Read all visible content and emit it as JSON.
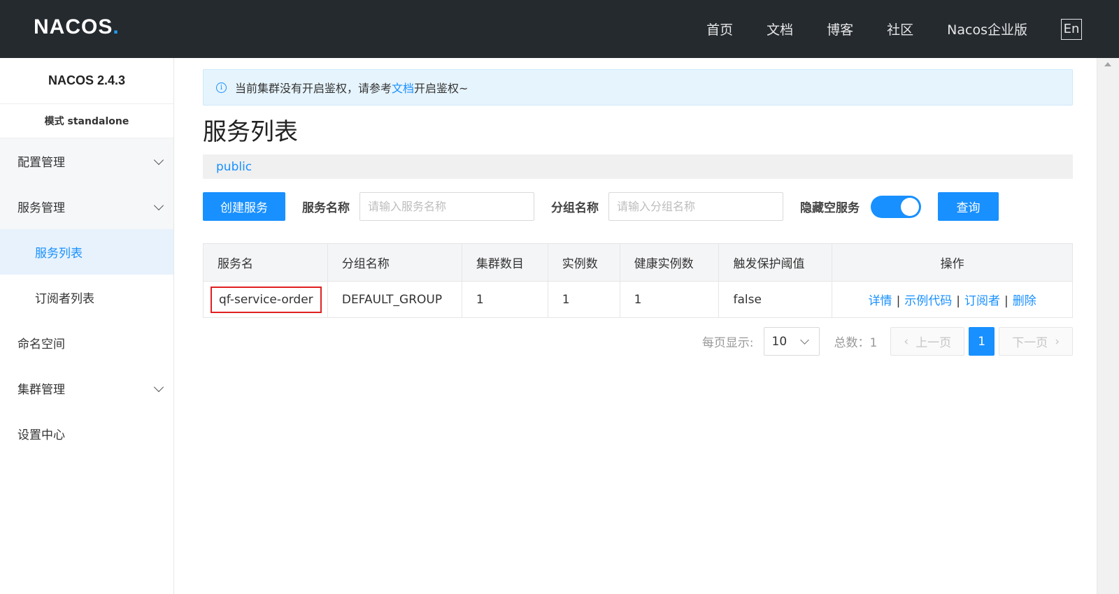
{
  "header": {
    "logo": "NACOS",
    "logo_dot": ".",
    "nav": [
      "首页",
      "文档",
      "博客",
      "社区",
      "Nacos企业版"
    ],
    "lang": "En"
  },
  "sidebar": {
    "version": "NACOS 2.4.3",
    "mode": "模式 standalone",
    "items": [
      {
        "label": "配置管理"
      },
      {
        "label": "服务管理"
      },
      {
        "label": "服务列表"
      },
      {
        "label": "订阅者列表"
      },
      {
        "label": "命名空间"
      },
      {
        "label": "集群管理"
      },
      {
        "label": "设置中心"
      }
    ]
  },
  "alert": {
    "prefix": "当前集群没有开启鉴权，请参考",
    "link": "文档",
    "suffix": "开启鉴权~"
  },
  "page": {
    "title": "服务列表",
    "namespace": "public"
  },
  "toolbar": {
    "create_label": "创建服务",
    "service_name_label": "服务名称",
    "service_name_placeholder": "请输入服务名称",
    "group_name_label": "分组名称",
    "group_name_placeholder": "请输入分组名称",
    "hide_empty_label": "隐藏空服务",
    "hide_empty_on": true,
    "query_label": "查询"
  },
  "table": {
    "headers": [
      "服务名",
      "分组名称",
      "集群数目",
      "实例数",
      "健康实例数",
      "触发保护阈值",
      "操作"
    ],
    "rows": [
      {
        "service": "qf-service-order",
        "group": "DEFAULT_GROUP",
        "clusters": "1",
        "instances": "1",
        "healthy": "1",
        "protect": "false",
        "ops": [
          "详情",
          "示例代码",
          "订阅者",
          "删除"
        ]
      }
    ]
  },
  "pager": {
    "per_page_label": "每页显示:",
    "per_page_value": "10",
    "total_label": "总数：1",
    "prev": "上一页",
    "page": "1",
    "next": "下一页"
  },
  "colors": {
    "accent": "#1890ff",
    "header_bg": "#252a2f",
    "highlight": "#e02020"
  }
}
